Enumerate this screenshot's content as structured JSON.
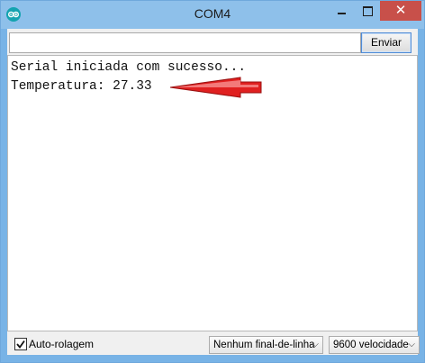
{
  "window": {
    "title": "COM4",
    "close_glyph": "✕"
  },
  "icons": {
    "app": "arduino-icon",
    "minimize": "minimize-icon",
    "maximize": "maximize-icon",
    "close": "close-icon",
    "chevron": "chevron-down-icon",
    "check": "check-icon",
    "arrow": "red-arrow-icon"
  },
  "colors": {
    "title_bar": "#8ec0ea",
    "close_button": "#c8504a",
    "arrow": "#e02020"
  },
  "toolbar": {
    "input_value": "",
    "send_label": "Enviar"
  },
  "output": {
    "lines": [
      "Serial iniciada com sucesso...",
      "Temperatura: 27.33"
    ]
  },
  "footer": {
    "autoscroll_label": "Auto-rolagem",
    "autoscroll_checked": true,
    "line_ending_value": "Nenhum final-de-linha",
    "baud_value": "9600 velocidade"
  }
}
